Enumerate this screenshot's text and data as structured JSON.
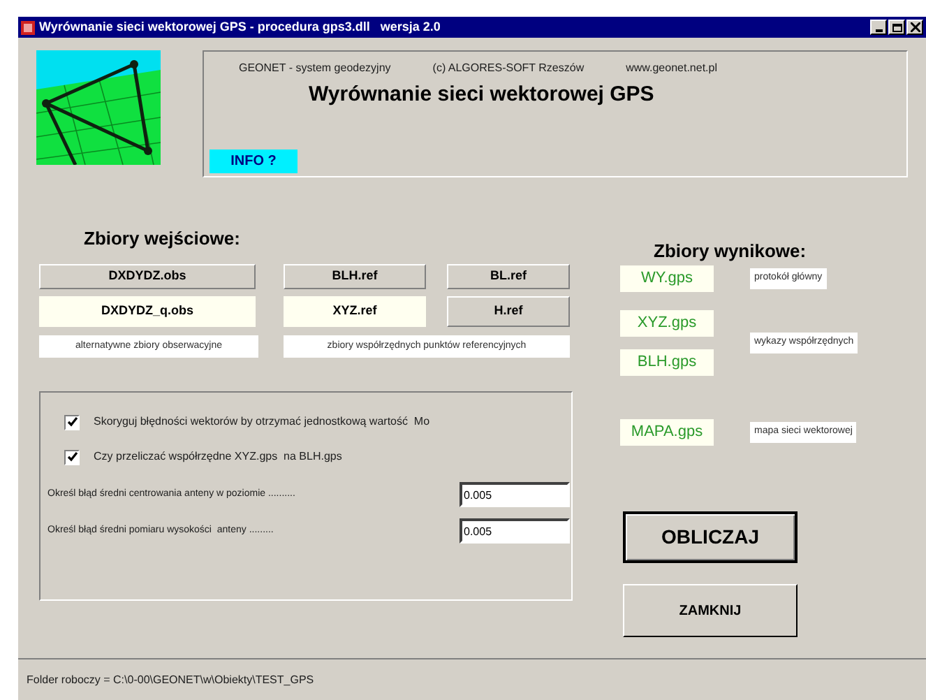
{
  "window": {
    "title": "Wyrównanie sieci wektorowej GPS - procedura gps3.dll   wersja 2.0"
  },
  "header": {
    "system": "GEONET - system geodezyjny",
    "copyright": "(c) ALGORES-SOFT Rzeszów",
    "website": "www.geonet.net.pl",
    "heading": "Wyrównanie sieci wektorowej GPS",
    "info_button": "INFO ?"
  },
  "input_files": {
    "heading": "Zbiory wejściowe:",
    "rows": [
      [
        {
          "label": "DXDYDZ.obs",
          "selected": false
        },
        {
          "label": "BLH.ref",
          "selected": false
        },
        {
          "label": "BL.ref",
          "selected": false
        }
      ],
      [
        {
          "label": "DXDYDZ_q.obs",
          "selected": true
        },
        {
          "label": "XYZ.ref",
          "selected": true
        },
        {
          "label": "H.ref",
          "selected": false
        }
      ]
    ],
    "notes": [
      "alternatywne zbiory obserwacyjne",
      "zbiory współrzędnych punktów referencyjnych"
    ]
  },
  "output_files": {
    "heading": "Zbiory wynikowe:",
    "groups": [
      {
        "files": [
          "WY.gps"
        ],
        "note": "protokół główny"
      },
      {
        "files": [
          "XYZ.gps",
          "BLH.gps"
        ],
        "note": "wykazy współrzędnych"
      },
      {
        "files": [
          "MAPA.gps"
        ],
        "note": "mapa sieci wektorowej"
      }
    ]
  },
  "options": [
    {
      "label": "Skoryguj błędności wektorów by otrzymać jednostkową wartość  Mo",
      "checked": true
    },
    {
      "label": "Czy przeliczać współrzędne XYZ.gps  na BLH.gps",
      "checked": true
    }
  ],
  "parameters": [
    {
      "label": "Określ błąd średni centrowania anteny w poziomie ..........",
      "value": "0.005"
    },
    {
      "label": "Określ błąd średni pomiaru wysokości  anteny .........",
      "value": "0.005"
    }
  ],
  "buttons": [
    "OBLICZAJ",
    "ZAMKNIJ"
  ],
  "status_bar": "Folder roboczy = C:\\0-00\\GEONET\\w\\Obiekty\\TEST_GPS"
}
